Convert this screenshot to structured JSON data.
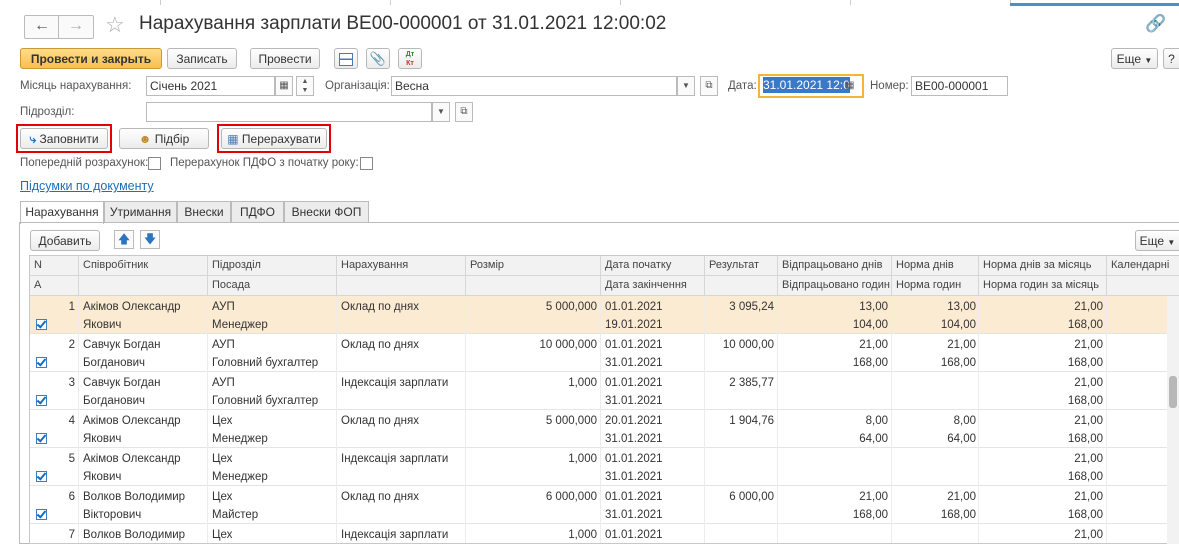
{
  "title": "Нарахування зарплати ВЕ00-000001 от 31.01.2021 12:00:02",
  "toolbar": {
    "post_and_close": "Провести и закрыть",
    "save": "Записать",
    "post": "Провести",
    "more": "Еще",
    "help": "?"
  },
  "form": {
    "month_label": "Місяць нарахування:",
    "month_value": "Січень 2021",
    "org_label": "Організація:",
    "org_value": "Весна",
    "date_label": "Дата:",
    "date_value": "31.01.2021 12:0",
    "number_label": "Номер:",
    "number_value": "ВЕ00-000001",
    "dept_label": "Підрозділ:",
    "dept_value": ""
  },
  "actions": {
    "fill": "Заповнити",
    "pick": "Підбір",
    "recalc": "Перерахувати"
  },
  "options": {
    "prelim_label": "Попередній розрахунок:",
    "pdfo_label": "Перерахунок ПДФО з початку року:"
  },
  "totals_link": "Підсумки по документу",
  "tabs": [
    "Нарахування",
    "Утримання",
    "Внески",
    "ПДФО",
    "Внески ФОП"
  ],
  "table_toolbar": {
    "add": "Добавить",
    "more": "Еще"
  },
  "table": {
    "headers_top": [
      "N",
      "Співробітник",
      "Підрозділ",
      "Нарахування",
      "Розмір",
      "Дата початку",
      "Результат",
      "Відпрацьовано днів",
      "Норма днів",
      "Норма днів за місяць",
      "Календарні"
    ],
    "headers_bottom": [
      "A",
      "",
      "Посада",
      "",
      "",
      "Дата закінчення",
      "",
      "Відпрацьовано годин",
      "Норма годин",
      "Норма годин за місяць",
      ""
    ],
    "rows": [
      {
        "n": "1",
        "emp1": "Акімов Олександр",
        "emp2": "Якович",
        "dept": "АУП",
        "pos": "Менеджер",
        "accrual": "Оклад по днях",
        "size": "5 000,000",
        "start": "01.01.2021",
        "end": "19.01.2021",
        "result": "3 095,24",
        "wd": "13,00",
        "wh": "104,00",
        "nd": "13,00",
        "nh": "104,00",
        "ndm": "21,00",
        "nhm": "168,00"
      },
      {
        "n": "2",
        "emp1": "Савчук Богдан",
        "emp2": "Богданович",
        "dept": "АУП",
        "pos": "Головний бухгалтер",
        "accrual": "Оклад по днях",
        "size": "10 000,000",
        "start": "01.01.2021",
        "end": "31.01.2021",
        "result": "10 000,00",
        "wd": "21,00",
        "wh": "168,00",
        "nd": "21,00",
        "nh": "168,00",
        "ndm": "21,00",
        "nhm": "168,00"
      },
      {
        "n": "3",
        "emp1": "Савчук Богдан",
        "emp2": "Богданович",
        "dept": "АУП",
        "pos": "Головний бухгалтер",
        "accrual": "Індексація зарплати",
        "size": "1,000",
        "start": "01.01.2021",
        "end": "31.01.2021",
        "result": "2 385,77",
        "wd": "",
        "wh": "",
        "nd": "",
        "nh": "",
        "ndm": "21,00",
        "nhm": "168,00"
      },
      {
        "n": "4",
        "emp1": "Акімов Олександр",
        "emp2": "Якович",
        "dept": "Цех",
        "pos": "Менеджер",
        "accrual": "Оклад по днях",
        "size": "5 000,000",
        "start": "20.01.2021",
        "end": "31.01.2021",
        "result": "1 904,76",
        "wd": "8,00",
        "wh": "64,00",
        "nd": "8,00",
        "nh": "64,00",
        "ndm": "21,00",
        "nhm": "168,00"
      },
      {
        "n": "5",
        "emp1": "Акімов Олександр",
        "emp2": "Якович",
        "dept": "Цех",
        "pos": "Менеджер",
        "accrual": "Індексація зарплати",
        "size": "1,000",
        "start": "01.01.2021",
        "end": "31.01.2021",
        "result": "",
        "wd": "",
        "wh": "",
        "nd": "",
        "nh": "",
        "ndm": "21,00",
        "nhm": "168,00"
      },
      {
        "n": "6",
        "emp1": "Волков Володимир",
        "emp2": "Вікторович",
        "dept": "Цех",
        "pos": "Майстер",
        "accrual": "Оклад по днях",
        "size": "6 000,000",
        "start": "01.01.2021",
        "end": "31.01.2021",
        "result": "6 000,00",
        "wd": "21,00",
        "wh": "168,00",
        "nd": "21,00",
        "nh": "168,00",
        "ndm": "21,00",
        "nhm": "168,00"
      },
      {
        "n": "7",
        "emp1": "Волков Володимир",
        "emp2": "",
        "dept": "Цех",
        "pos": "",
        "accrual": "Індексація зарплати",
        "size": "1,000",
        "start": "01.01.2021",
        "end": "",
        "result": "",
        "wd": "",
        "wh": "",
        "nd": "",
        "nh": "",
        "ndm": "21,00",
        "nhm": ""
      }
    ]
  },
  "colors": {
    "primary": "#f6c14e",
    "highlight": "#e30000",
    "link": "#1d6fb8",
    "selected_row": "#fbebd2"
  }
}
